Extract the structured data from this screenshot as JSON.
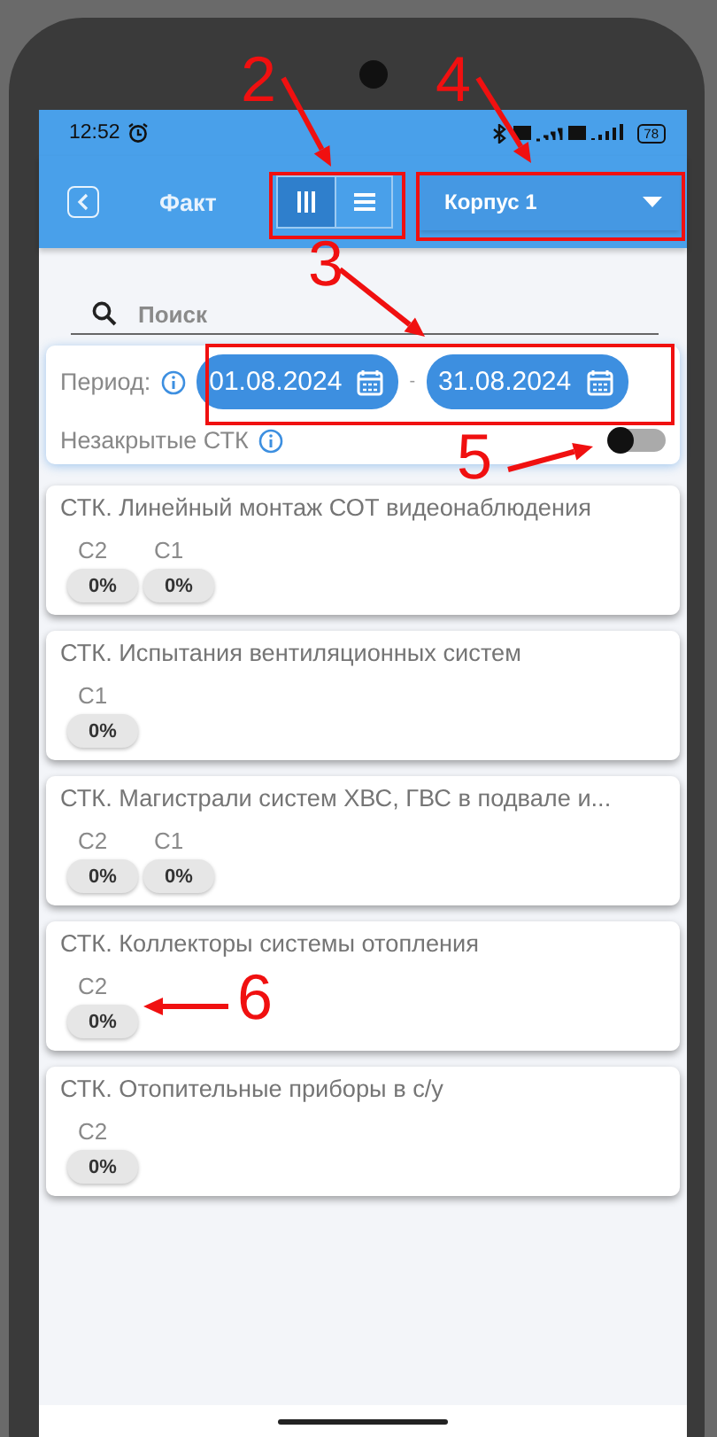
{
  "status_bar": {
    "time": "12:52",
    "battery": "78"
  },
  "toolbar": {
    "title": "Факт",
    "view_modes": [
      {
        "kind": "columns",
        "selected": true
      },
      {
        "kind": "rows",
        "selected": false
      }
    ],
    "building_select": "Корпус 1"
  },
  "search": {
    "placeholder": "Поиск"
  },
  "filter": {
    "period_label": "Период:",
    "date_from": "01.08.2024",
    "separator": "-",
    "date_to": "31.08.2024",
    "unclosed_label": "Незакрытые СТК",
    "unclosed_on": false
  },
  "cards": [
    {
      "title": "СТК. Линейный монтаж СОТ видеонаблюдения",
      "stages": [
        {
          "label": "C2",
          "value": "0%"
        },
        {
          "label": "C1",
          "value": "0%"
        }
      ]
    },
    {
      "title": "СТК. Испытания вентиляционных систем",
      "stages": [
        {
          "label": "C1",
          "value": "0%"
        }
      ]
    },
    {
      "title": "СТК. Магистрали систем ХВС, ГВС в подвале и...",
      "stages": [
        {
          "label": "C2",
          "value": "0%"
        },
        {
          "label": "C1",
          "value": "0%"
        }
      ]
    },
    {
      "title": "СТК. Коллекторы системы отопления",
      "stages": [
        {
          "label": "C2",
          "value": "0%"
        }
      ]
    },
    {
      "title": "СТК. Отопительные приборы в с/у",
      "stages": [
        {
          "label": "C2",
          "value": "0%"
        }
      ]
    }
  ],
  "callouts": [
    {
      "label": "2"
    },
    {
      "label": "3"
    },
    {
      "label": "4"
    },
    {
      "label": "5"
    },
    {
      "label": "6"
    }
  ]
}
